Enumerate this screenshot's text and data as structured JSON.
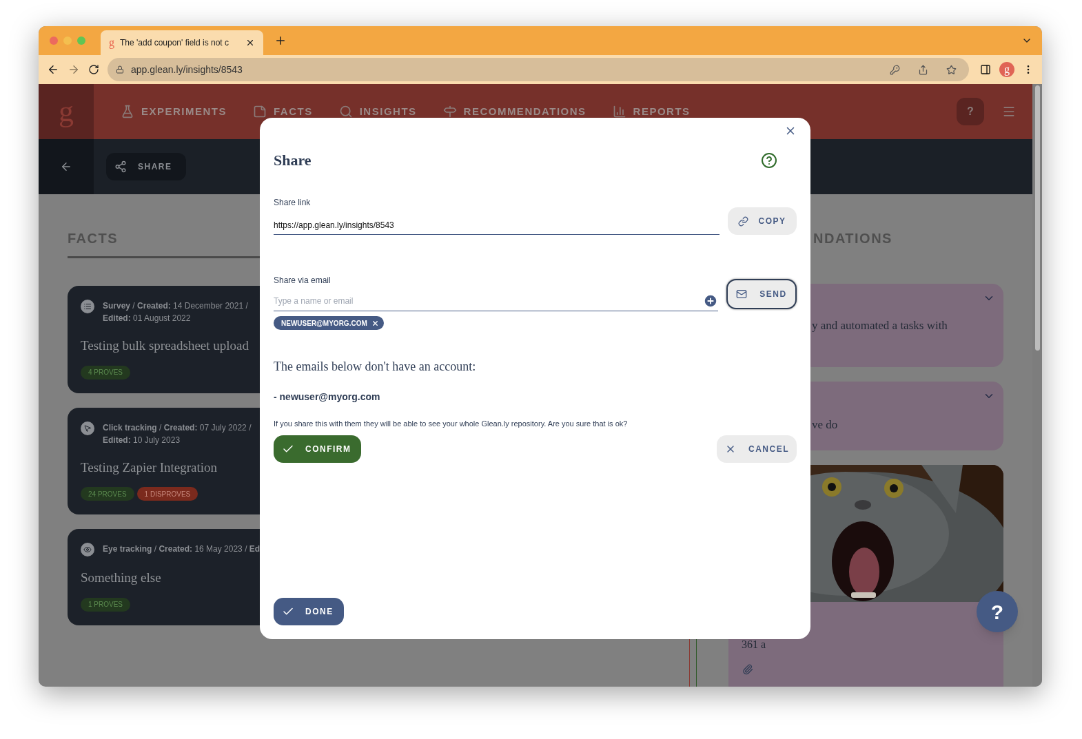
{
  "browser": {
    "tabs": [
      {
        "title": "The 'add coupon' field is not c",
        "selected": true,
        "favicon": "g"
      }
    ],
    "url": "app.glean.ly/insights/8543",
    "profile": "g"
  },
  "nav": {
    "logo": "g",
    "items": [
      {
        "label": "EXPERIMENTS",
        "kind": "flask"
      },
      {
        "label": "FACTS",
        "kind": "note"
      },
      {
        "label": "INSIGHTS",
        "kind": "search"
      },
      {
        "label": "RECOMMENDATIONS",
        "kind": "sign"
      },
      {
        "label": "REPORTS",
        "kind": "chart"
      }
    ],
    "help": "?"
  },
  "toolbar": {
    "share": "SHARE"
  },
  "facts": {
    "heading": "FACTS",
    "cards": [
      {
        "kind": "survey",
        "meta_lines": [
          "**Survey** / **Created:** 14 December 2021 /",
          "**Edited:** 01 August 2022"
        ],
        "title": "Testing bulk spreadsheet upload",
        "badges": [
          {
            "label": "4 PROVES",
            "kind": "prove"
          }
        ]
      },
      {
        "kind": "click",
        "meta_lines": [
          "**Click tracking** / **Created:** 07 July 2022 /",
          "**Edited:** 10 July 2023"
        ],
        "title": "Testing Zapier Integration",
        "badges": [
          {
            "label": "24 PROVES",
            "kind": "prove"
          },
          {
            "label": "1 DISPROVES",
            "kind": "disprove"
          }
        ]
      },
      {
        "kind": "eye",
        "meta_lines": [
          "**Eye tracking** / **Created:** 16 May 2023 / **Ed**"
        ],
        "title": "Something else",
        "badges": [
          {
            "label": "1 PROVES",
            "kind": "prove"
          }
        ]
      }
    ]
  },
  "recommendations": {
    "heading": "NDATIONS",
    "cards": [
      {
        "kind": "text",
        "text": "y and automated a tasks with"
      },
      {
        "kind": "text",
        "text": "ve do"
      },
      {
        "kind": "picture",
        "text": "361 a"
      }
    ]
  },
  "modal": {
    "title": "Share",
    "share_link": {
      "label": "Share link",
      "value": "https://app.glean.ly/insights/8543"
    },
    "copy_button": "COPY",
    "share_email": {
      "label": "Share via email",
      "placeholder": "Type a name or email"
    },
    "send_button": "SEND",
    "chips": [
      {
        "label": "NEWUSER@MYORG.COM"
      }
    ],
    "warning": {
      "heading": "The emails below don't have an account:",
      "emails": [
        "- newuser@myorg.com"
      ],
      "note": "If you share this with them they will be able to see your whole Glean.ly repository. Are you sure that is ok?"
    },
    "confirm_button": "CONFIRM",
    "cancel_button": "CANCEL",
    "done_button": "DONE"
  },
  "help_fab": "?"
}
